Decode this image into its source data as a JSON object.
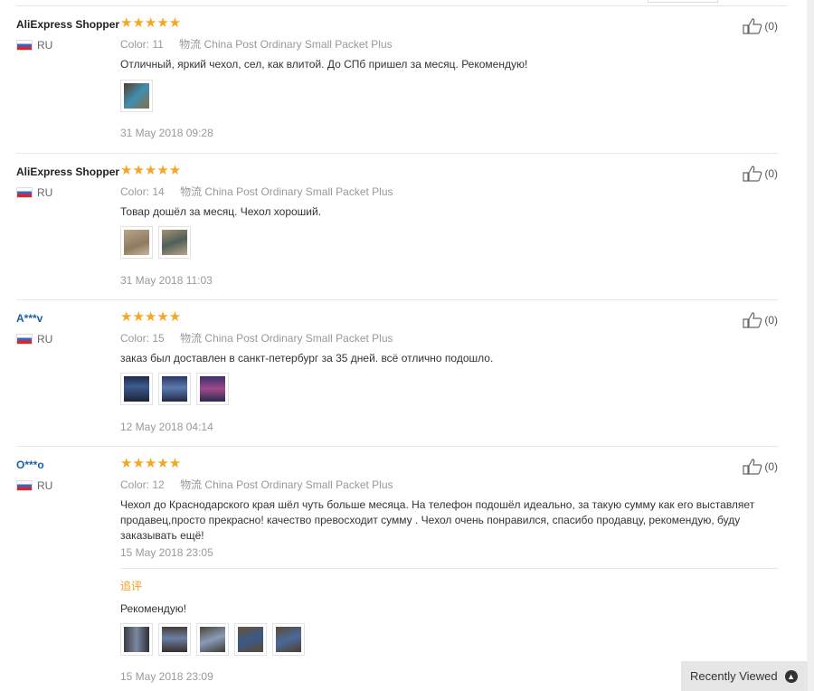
{
  "reviews": [
    {
      "name": "AliExpress Shopper",
      "country": "RU",
      "stars": "★★★★★",
      "color_label": "Color:",
      "color_value": "11",
      "logistics_label": "物流",
      "logistics_value": "China Post Ordinary Small Packet Plus",
      "text": "Отличный, яркий чехол, сел, как влитой. До СПб пришел за месяц. Рекомендую!",
      "date": "31 May 2018 09:28",
      "likes": "(0)"
    },
    {
      "name": "AliExpress Shopper",
      "country": "RU",
      "stars": "★★★★★",
      "color_label": "Color:",
      "color_value": "14",
      "logistics_label": "物流",
      "logistics_value": "China Post Ordinary Small Packet Plus",
      "text": "Товар дошёл за месяц. Чехол хороший.",
      "date": "31 May 2018 11:03",
      "likes": "(0)"
    },
    {
      "name": "A***v",
      "country": "RU",
      "stars": "★★★★★",
      "color_label": "Color:",
      "color_value": "15",
      "logistics_label": "物流",
      "logistics_value": "China Post Ordinary Small Packet Plus",
      "text": "заказ был доставлен в санкт-петербург за 35 дней. всё отлично подошло.",
      "date": "12 May 2018 04:14",
      "likes": "(0)"
    },
    {
      "name": "O***o",
      "country": "RU",
      "stars": "★★★★★",
      "color_label": "Color:",
      "color_value": "12",
      "logistics_label": "物流",
      "logistics_value": "China Post Ordinary Small Packet Plus",
      "text": "Чехол до Краснодарского края шёл чуть больше месяца. На телефон подошёл идеально, за такую сумму как его выставляет продавец,просто прекрасно! качество превосходит сумму . Чехол очень понравился, спасибо продавцу, рекомендую, буду заказывать ещё!",
      "date": "15 May 2018 23:05",
      "likes": "(0)",
      "followup_label": "追评",
      "followup_text": "Рекомендую!",
      "followup_date": "15 May 2018 23:09"
    }
  ],
  "recently_viewed": "Recently Viewed",
  "icons": {
    "like": "thumbs-up-icon",
    "flag": "russia-flag-icon",
    "chevron": "chevron-up-icon"
  },
  "colors": {
    "star": "#f5a623",
    "followup": "#f0a020",
    "masked_name": "#1a5fa8"
  }
}
